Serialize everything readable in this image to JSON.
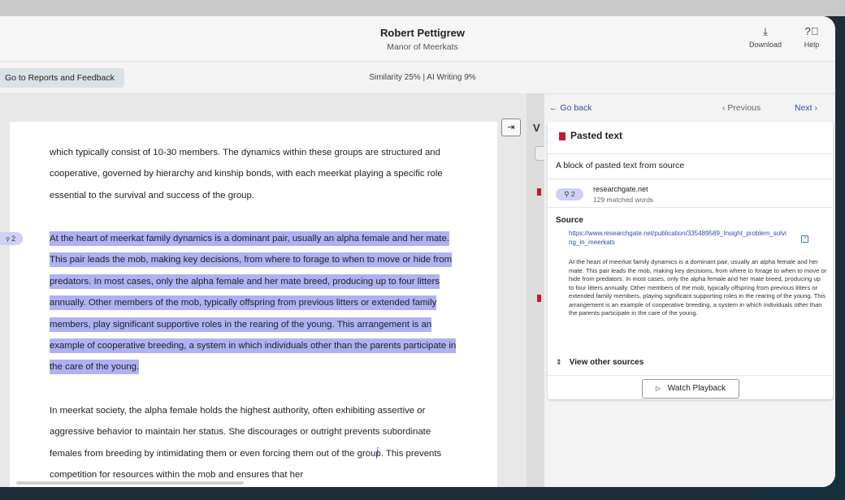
{
  "header": {
    "student_name": "Robert Pettigrew",
    "assignment_title": "Manor of Meerkats",
    "download_label": "Download",
    "help_label": "Help",
    "download_icon": "download-icon",
    "help_icon": "help-circle-icon"
  },
  "toolbar": {
    "reports_button": "Go to Reports and Feedback",
    "scores": "Similarity 25%  |  AI Writing 9%"
  },
  "document": {
    "paragraph_1": "which typically consist of 10-30 members. The dynamics within these groups are structured and cooperative, governed by hierarchy and kinship bonds, with each meerkat playing a specific role essential to the survival and success of the group.",
    "paragraph_2_highlighted": "At the heart of meerkat family dynamics is a dominant pair, usually an alpha female and her mate. This pair leads the mob, making key decisions, from where to forage to when to move or hide from predators. In most cases, only the alpha female and her mate breed, producing up to four litters annually. Other members of the mob, typically offspring from previous litters or extended family members, play significant supportive roles in the rearing of the young. This arrangement is an example of cooperative breeding, a system in which individuals other than the parents participate in the care of the young.",
    "paragraph_3": "In meerkat society, the alpha female holds the highest authority, often exhibiting assertive or aggressive behavior to maintain her status. She discourages or outright prevents subordinate females from breeding by intimidating them or even forcing them out of the group. This prevents competition for resources within the mob and ensures that her",
    "match_badge": "2",
    "highlight_color": "#aeb1f3"
  },
  "strip": {
    "letter": "V"
  },
  "panel": {
    "go_back": "Go back",
    "previous": "Previous",
    "next": "Next",
    "card_title": "Pasted text",
    "card_description": "A block of pasted text from source",
    "match_number": "2",
    "match_domain": "researchgate.net",
    "match_words": "129 matched words",
    "source_label": "Source",
    "source_url": "https://www.researchgate.net/publication/335489589_Insight_problem_solving_in_meerkats",
    "source_text": "At the heart of meerkat family dynamics is a dominant pair, usually an alpha female and her mate. This pair leads the mob, making key decisions, from where to forage to when to move or hide from predators. In most cases, only the alpha female and her mate breed, producing up to four litters annually. Other members of the mob, typically offspring from previous litters or extended family members, playing significant supporting roles in the rearing of the young. This arrangement is an example of cooperative breeding, a system in which individuals other than the parents participate in the care of the young.",
    "view_other_sources": "View other sources",
    "watch_playback": "Watch Playback",
    "flag_color": "#c21b2b",
    "link_color": "#2f4ea8"
  }
}
